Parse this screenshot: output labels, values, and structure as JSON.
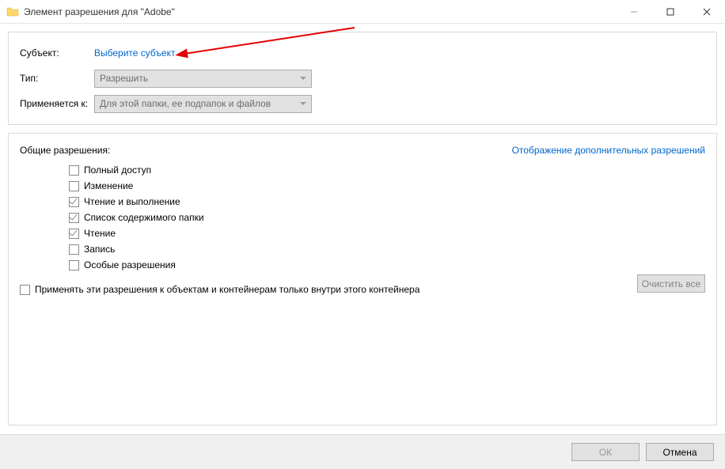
{
  "titlebar": {
    "title": "Элемент разрешения для \"Adobe\""
  },
  "form": {
    "subject_label": "Субъект:",
    "subject_link": "Выберите субъект",
    "type_label": "Тип:",
    "type_value": "Разрешить",
    "applies_label": "Применяется к:",
    "applies_value": "Для этой папки, ее подпапок и файлов"
  },
  "permissions": {
    "header": "Общие разрешения:",
    "advanced_link": "Отображение дополнительных разрешений",
    "items": [
      {
        "label": "Полный доступ",
        "checked": false
      },
      {
        "label": "Изменение",
        "checked": false
      },
      {
        "label": "Чтение и выполнение",
        "checked": true
      },
      {
        "label": "Список содержимого папки",
        "checked": true
      },
      {
        "label": "Чтение",
        "checked": true
      },
      {
        "label": "Запись",
        "checked": false
      },
      {
        "label": "Особые разрешения",
        "checked": false
      }
    ],
    "apply_inherit": "Применять эти разрешения к объектам и контейнерам только внутри этого контейнера",
    "clear_all": "Очистить все"
  },
  "buttons": {
    "ok": "ОК",
    "cancel": "Отмена"
  }
}
